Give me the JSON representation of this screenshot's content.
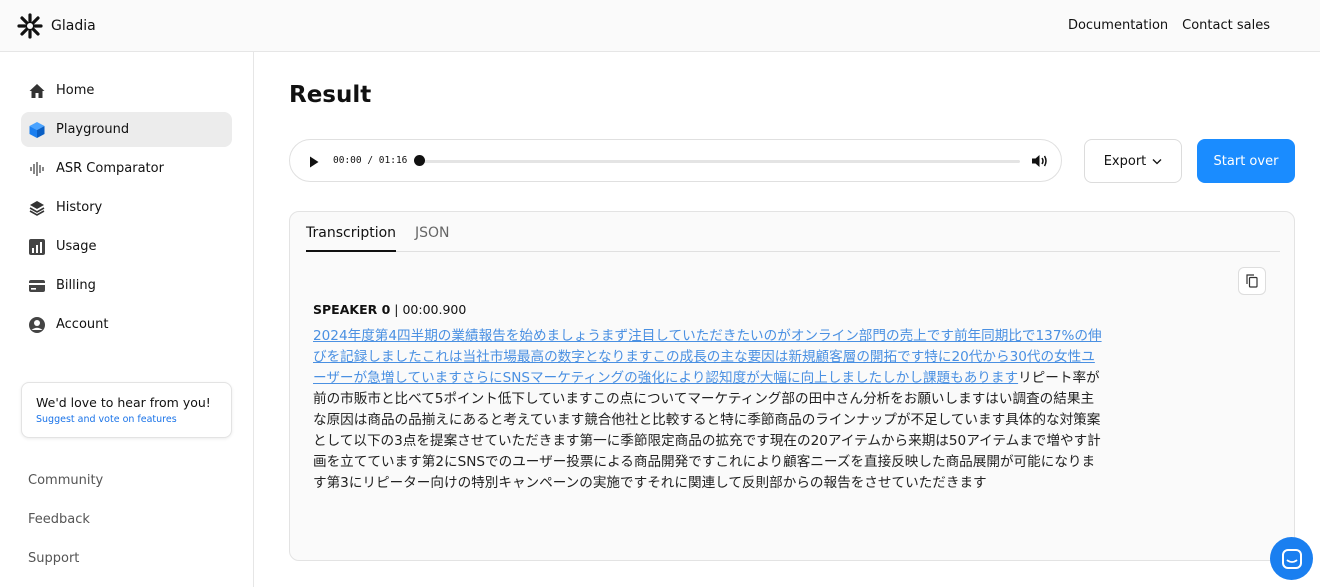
{
  "brand": {
    "name": "Gladia"
  },
  "top_nav": {
    "documentation": "Documentation",
    "contact_sales": "Contact sales"
  },
  "sidebar": {
    "items": [
      {
        "label": "Home",
        "icon": "home-icon",
        "active": false
      },
      {
        "label": "Playground",
        "icon": "cube-icon",
        "active": true
      },
      {
        "label": "ASR Comparator",
        "icon": "waveform-icon",
        "active": false
      },
      {
        "label": "History",
        "icon": "layers-icon",
        "active": false
      },
      {
        "label": "Usage",
        "icon": "bar-chart-icon",
        "active": false
      },
      {
        "label": "Billing",
        "icon": "credit-card-icon",
        "active": false
      },
      {
        "label": "Account",
        "icon": "user-circle-icon",
        "active": false
      }
    ],
    "feedback": {
      "title": "We'd love to hear from you!",
      "link": "Suggest and vote on features"
    },
    "links": [
      "Community",
      "Feedback",
      "Support"
    ]
  },
  "main": {
    "title": "Result",
    "player": {
      "current_time": "00:00",
      "duration": "01:16",
      "progress": 0
    },
    "export_label": "Export",
    "start_over_label": "Start over",
    "tabs": [
      {
        "label": "Transcription",
        "active": true
      },
      {
        "label": "JSON",
        "active": false
      }
    ],
    "speaker": {
      "name": "SPEAKER 0",
      "timestamp": "00:00.900"
    },
    "transcript": {
      "active_segment": "2024年度第4四半期の業績報告を始めましょうまず注目していただきたいのがオンライン部門の売上です前年同期比で137%の伸びを記録しましたこれは当社市場最高の数字となりますこの成長の主な要因は新規顧客層の開拓です特に20代から30代の女性ユーザーが急増していますさらにSNSマーケティングの強化により認知度が大幅に向上しましたしかし課題もあります",
      "rest": "リピート率が前の市販市と比べて5ポイント低下していますこの点についてマーケティング部の田中さん分析をお願いしますはい調査の結果主な原因は商品の品揃えにあると考えています競合他社と比較すると特に季節商品のラインナップが不足しています具体的な対策案として以下の3点を提案させていただきます第一に季節限定商品の拡充です現在の20アイテムから来期は50アイテムまで増やす計画を立てています第2にSNSでのユーザー投票による商品開発ですこれにより顧客ニーズを直接反映した商品展開が可能になります第3にリピーター向けの特別キャンペーンの実施ですそれに関連して反則部からの報告をさせていただきます"
    }
  },
  "colors": {
    "accent": "#1a8cff",
    "active_text": "#4a90e2"
  }
}
